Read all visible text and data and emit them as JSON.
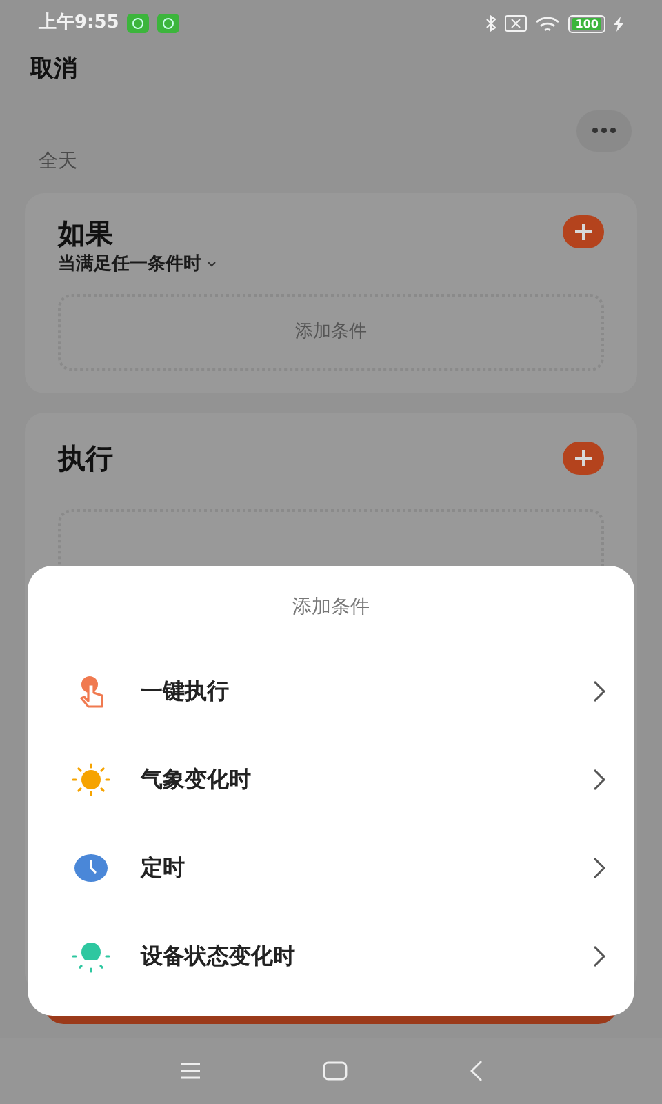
{
  "status_bar": {
    "time": "上午9:55",
    "battery": "100"
  },
  "header": {
    "cancel": "取消"
  },
  "schedule": "全天",
  "if_card": {
    "title": "如果",
    "mode": "当满足任一条件时",
    "placeholder": "添加条件"
  },
  "do_card": {
    "title": "执行"
  },
  "sheet": {
    "title": "添加条件",
    "items": [
      {
        "kind": "tap",
        "label": "一键执行"
      },
      {
        "kind": "weather",
        "label": "气象变化时"
      },
      {
        "kind": "timer",
        "label": "定时"
      },
      {
        "kind": "device",
        "label": "设备状态变化时"
      }
    ]
  }
}
